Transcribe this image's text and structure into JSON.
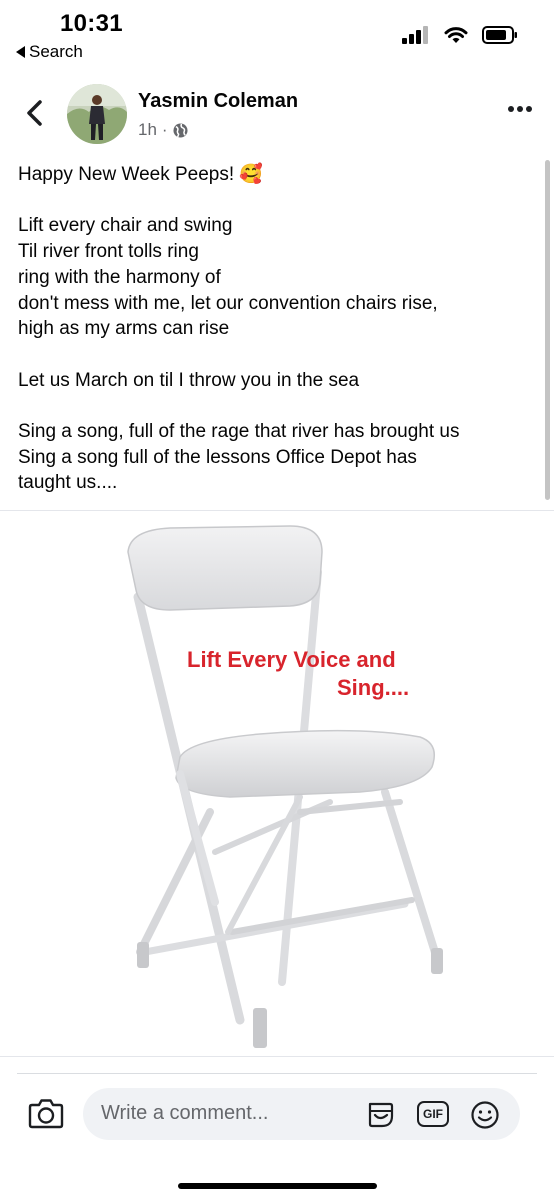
{
  "status_bar": {
    "time": "10:31",
    "back_app_label": "Search",
    "icons": [
      "signal-icon",
      "wifi-icon",
      "battery-icon"
    ]
  },
  "post": {
    "author": "Yasmin Coleman",
    "time_ago": "1h",
    "separator": "·",
    "audience_icon": "globe-icon",
    "lines": [
      "Happy New Week Peeps! 🥰",
      "",
      "Lift every chair and swing",
      "Til river front tolls ring",
      "ring with the harmony of",
      "don't mess with me, let our convention chairs rise,",
      "high as my arms can rise",
      "",
      "Let us March on til I throw you in the sea",
      "",
      "Sing a song, full of the rage that river has brought us",
      "Sing a song full of the lessons Office Depot has",
      "taught us...."
    ],
    "image": {
      "caption_line1": "Lift Every Voice and",
      "caption_line2": "Sing....",
      "caption_color": "#d8242c"
    }
  },
  "comment_bar": {
    "placeholder": "Write a comment...",
    "icons": [
      "camera-icon",
      "sticker-icon",
      "gif-icon",
      "emoji-icon"
    ],
    "gif_label": "GIF"
  },
  "colors": {
    "text": "#050505",
    "meta": "#65676b",
    "input_bg": "#f0f2f5"
  }
}
